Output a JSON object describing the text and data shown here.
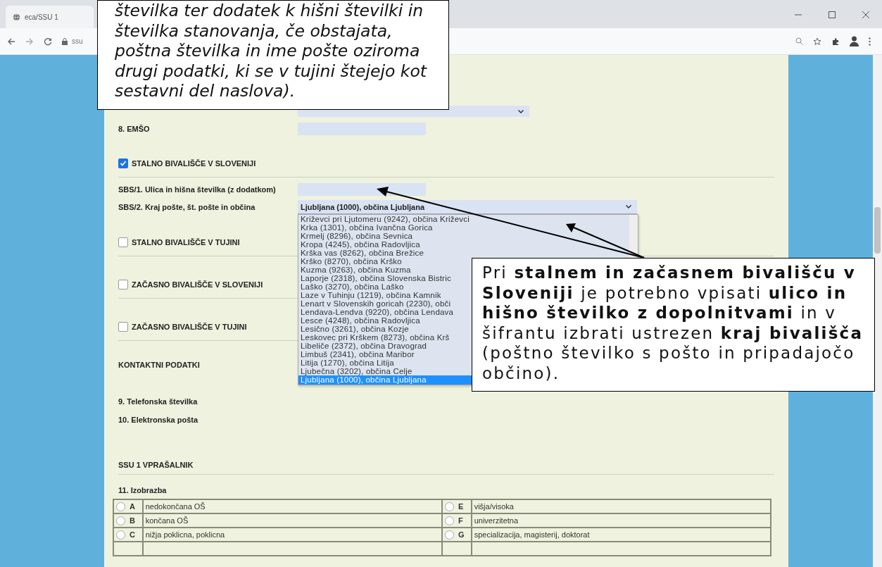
{
  "browser": {
    "tab_title": "eca/SSU 1",
    "address": "ssu"
  },
  "sections": [
    {
      "kind": "field",
      "label": "8. EMŠO"
    },
    {
      "kind": "check",
      "label": "STALNO BIVALIŠČE V SLOVENIJI",
      "checked": true
    },
    {
      "kind": "field",
      "label": "SBS/1. Ulica in hišna številka (z dodatkom)"
    },
    {
      "kind": "select",
      "label": "SBS/2. Kraj pošte, št. pošte in občina",
      "value": "Ljubljana (1000), občina Ljubljana",
      "expanded": true,
      "options": [
        {
          "label": "Križevci pri Ljutomeru (9242), občina Križevci",
          "selected": false
        },
        {
          "label": "Krka (1301), občina Ivančna Gorica",
          "selected": false
        },
        {
          "label": "Krmelj (8296), občina Sevnica",
          "selected": false
        },
        {
          "label": "Kropa (4245), občina Radovljica",
          "selected": false
        },
        {
          "label": "Krška vas (8262), občina Brežice",
          "selected": false
        },
        {
          "label": "Krško (8270), občina Krško",
          "selected": false
        },
        {
          "label": "Kuzma (9263), občina Kuzma",
          "selected": false
        },
        {
          "label": "Laporje (2318), občina Slovenska Bistric",
          "selected": false
        },
        {
          "label": "Laško (3270), občina Laško",
          "selected": false
        },
        {
          "label": "Laze v Tuhinju (1219), občina Kamnik",
          "selected": false
        },
        {
          "label": "Lenart v Slovenskih goricah (2230), obči",
          "selected": false
        },
        {
          "label": "Lendava-Lendva (9220), občina Lendava",
          "selected": false
        },
        {
          "label": "Lesce (4248), občina Radovljica",
          "selected": false
        },
        {
          "label": "Lesično (3261), občina Kozje",
          "selected": false
        },
        {
          "label": "Leskovec pri Krškem (8273), občina Krš",
          "selected": false
        },
        {
          "label": "Libeliče (2372), občina Dravograd",
          "selected": false
        },
        {
          "label": "Limbuš (2341), občina Maribor",
          "selected": false
        },
        {
          "label": "Litija (1270), občina Litija",
          "selected": false
        },
        {
          "label": "Ljubečna (3202), občina Celje",
          "selected": false
        },
        {
          "label": "Ljubljana (1000), občina Ljubljana",
          "selected": true
        }
      ]
    },
    {
      "kind": "check",
      "label": "STALNO BIVALIŠČE V TUJINI",
      "checked": false
    },
    {
      "kind": "check",
      "label": "ZAČASNO BIVALIŠČE V SLOVENIJI",
      "checked": false
    },
    {
      "kind": "check",
      "label": "ZAČASNO BIVALIŠČE V TUJINI",
      "checked": false
    },
    {
      "kind": "heading",
      "label": "KONTAKTNI PODATKI"
    },
    {
      "kind": "label",
      "label": "9. Telefonska številka"
    },
    {
      "kind": "label",
      "label": "10. Elektronska pošta"
    },
    {
      "kind": "heading",
      "label": "SSU 1 VPRAŠALNIK"
    },
    {
      "kind": "radio-group",
      "label": "11. Izobrazba",
      "options": [
        {
          "letter": "A",
          "label": "nedokončana OŠ",
          "selected": false
        },
        {
          "letter": "E",
          "label": "višja/visoka",
          "selected": false
        },
        {
          "letter": "B",
          "label": "končana OŠ",
          "selected": false
        },
        {
          "letter": "F",
          "label": "univerzitetna",
          "selected": false
        },
        {
          "letter": "C",
          "label": "nižja poklicna, poklicna",
          "selected": false
        },
        {
          "letter": "G",
          "label": "specializacija, magisterij, doktorat",
          "selected": false
        }
      ]
    }
  ],
  "callouts": [
    {
      "kind": "top",
      "lines": [
        "številka ter dodatek k hišni številki in",
        "številka stanovanja, če obstajata,",
        "poštna številka in ime pošte oziroma",
        "drugi podatki, ki se v tujini štejejo kot",
        "sestavni del naslova)."
      ]
    },
    {
      "kind": "side",
      "text": "Pri **stalnem in začasnem bivališču v Sloveniji** je potrebno vpisati **ulico in hišno številko z dopolnitvami** in v šifrantu izbrati ustrezen **kraj bivališča** (poštno številko s pošto in pripadajočo občino)."
    }
  ]
}
